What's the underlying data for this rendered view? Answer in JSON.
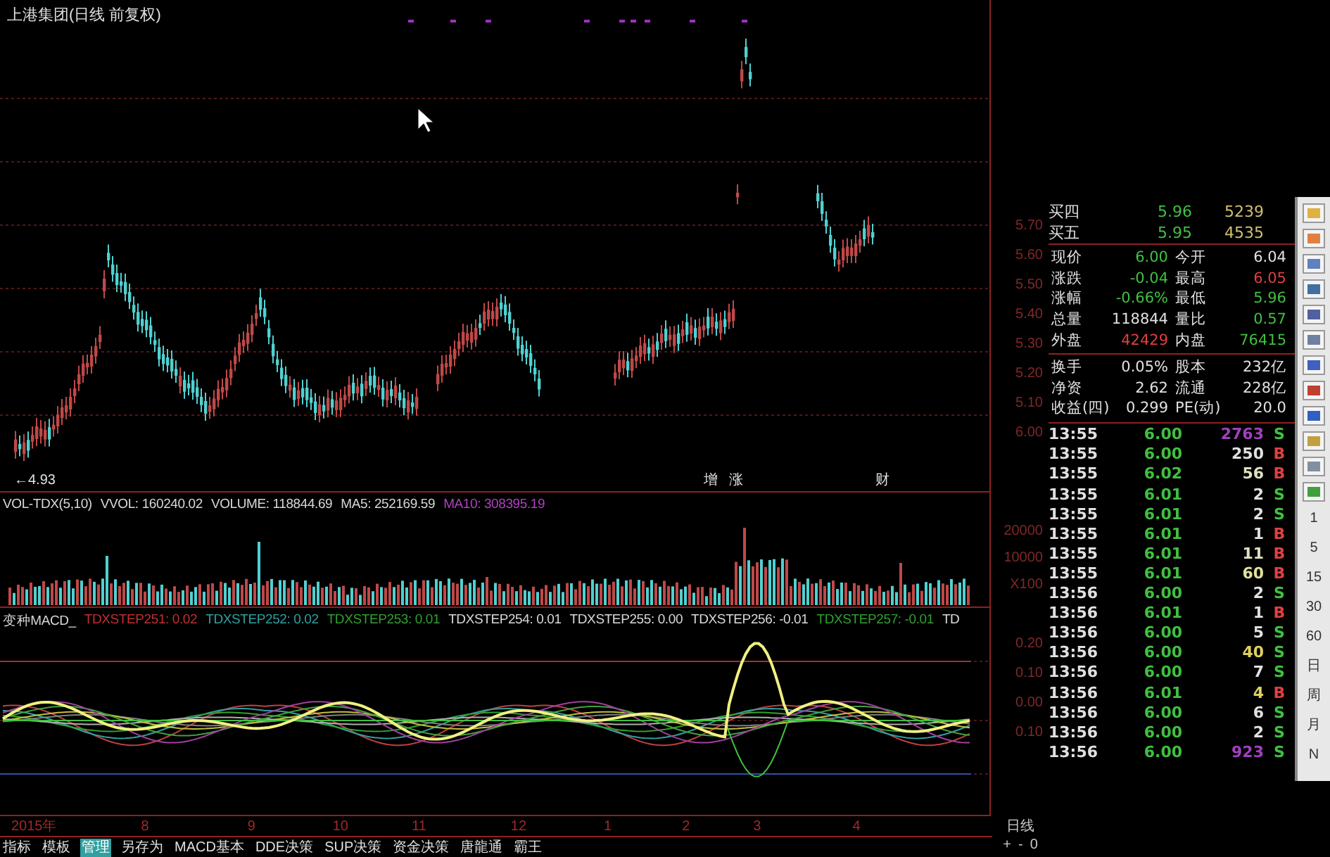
{
  "chart_title": "上港集团(日线 前复权)",
  "low_label": "←4.93",
  "event_markers": [
    "增",
    "涨",
    "财"
  ],
  "price_axis": [
    "5.70",
    "5.60",
    "5.50",
    "5.40",
    "5.30",
    "5.20",
    "5.10",
    "6.00"
  ],
  "volume": {
    "indicator": "VOL-TDX(5,10)",
    "readings": [
      {
        "text": "VVOL: 160240.02",
        "color": "#d8d8d8"
      },
      {
        "text": "VOLUME: 118844.69",
        "color": "#d8d8d8"
      },
      {
        "text": "MA5: 252169.59",
        "color": "#d8d8d8"
      },
      {
        "text": "MA10: 308395.19",
        "color": "#b040c0"
      }
    ],
    "axis": [
      "20000",
      "10000",
      "X100"
    ]
  },
  "macd": {
    "indicator": "变种MACD_",
    "readings": [
      {
        "text": "TDXSTEP251: 0.02",
        "color": "#c03030"
      },
      {
        "text": "TDXSTEP252: 0.02",
        "color": "#30a0a0"
      },
      {
        "text": "TDXSTEP253: 0.01",
        "color": "#30a030"
      },
      {
        "text": "TDXSTEP254: 0.01",
        "color": "#d8d8d8"
      },
      {
        "text": "TDXSTEP255: 0.00",
        "color": "#d8d8d8"
      },
      {
        "text": "TDXSTEP256: -0.01",
        "color": "#d8d8d8"
      },
      {
        "text": "TDXSTEP257: -0.01",
        "color": "#30a030"
      },
      {
        "text": "TD",
        "color": "#d8d8d8"
      }
    ],
    "axis": [
      "0.20",
      "0.10",
      "0.00",
      "0.10"
    ]
  },
  "date_axis": [
    "2015年",
    "8",
    "9",
    "10",
    "11",
    "12",
    "1",
    "2",
    "3",
    "4"
  ],
  "period_label": "日线",
  "zoom_controls": [
    "+",
    "-",
    "0"
  ],
  "tabs": [
    {
      "label": "指标",
      "selected": false
    },
    {
      "label": "模板",
      "selected": false
    },
    {
      "label": "管理",
      "selected": true
    },
    {
      "label": "另存为",
      "selected": false
    },
    {
      "label": "MACD基本",
      "selected": false
    },
    {
      "label": "DDE决策",
      "selected": false
    },
    {
      "label": "SUP决策",
      "selected": false
    },
    {
      "label": "资金决策",
      "selected": false
    },
    {
      "label": "唐龍通",
      "selected": false
    },
    {
      "label": "霸王",
      "selected": false
    }
  ],
  "quote": {
    "bids": [
      {
        "label": "买四",
        "price": "5.96",
        "volume": "5239"
      },
      {
        "label": "买五",
        "price": "5.95",
        "volume": "4535"
      }
    ],
    "sections": [
      [
        {
          "left": {
            "label": "现价",
            "value": "6.00",
            "color": "#40c040"
          },
          "right": {
            "label": "今开",
            "value": "6.04",
            "color": "#e0e0e0"
          }
        },
        {
          "left": {
            "label": "涨跌",
            "value": "-0.04",
            "color": "#40c040"
          },
          "right": {
            "label": "最高",
            "value": "6.05",
            "color": "#e04040"
          }
        },
        {
          "left": {
            "label": "涨幅",
            "value": "-0.66%",
            "color": "#40c040"
          },
          "right": {
            "label": "最低",
            "value": "5.96",
            "color": "#40c040"
          }
        },
        {
          "left": {
            "label": "总量",
            "value": "118844",
            "color": "#e0e0e0"
          },
          "right": {
            "label": "量比",
            "value": "0.57",
            "color": "#40c040"
          }
        },
        {
          "left": {
            "label": "外盘",
            "value": "42429",
            "color": "#e04040"
          },
          "right": {
            "label": "内盘",
            "value": "76415",
            "color": "#40c040"
          }
        }
      ],
      [
        {
          "left": {
            "label": "换手",
            "value": "0.05%",
            "color": "#e0e0e0"
          },
          "right": {
            "label": "股本",
            "value": "232亿",
            "color": "#e0e0e0"
          }
        },
        {
          "left": {
            "label": "净资",
            "value": "2.62",
            "color": "#e0e0e0"
          },
          "right": {
            "label": "流通",
            "value": "228亿",
            "color": "#e0e0e0"
          }
        },
        {
          "left": {
            "label": "收益(四)",
            "value": "0.299",
            "color": "#e0e0e0"
          },
          "right": {
            "label": "PE(动)",
            "value": "20.0",
            "color": "#e0e0e0"
          }
        }
      ]
    ]
  },
  "trades": [
    {
      "time": "13:55",
      "price": "6.00",
      "volume": {
        "text": "2763",
        "color": "#a040c0"
      },
      "side": {
        "text": "S",
        "color": "#40c040"
      }
    },
    {
      "time": "13:55",
      "price": "6.00",
      "volume": {
        "text": "250",
        "color": "#e0e0e0"
      },
      "side": {
        "text": "B",
        "color": "#e04040"
      }
    },
    {
      "time": "13:55",
      "price": "6.02",
      "volume": {
        "text": "56",
        "color": "#e0e0c0"
      },
      "side": {
        "text": "B",
        "color": "#e04040"
      }
    },
    {
      "time": "13:55",
      "price": "6.01",
      "volume": {
        "text": "2",
        "color": "#e0e0e0"
      },
      "side": {
        "text": "S",
        "color": "#40c040"
      }
    },
    {
      "time": "13:55",
      "price": "6.01",
      "volume": {
        "text": "2",
        "color": "#e0e0e0"
      },
      "side": {
        "text": "S",
        "color": "#40c040"
      }
    },
    {
      "time": "13:55",
      "price": "6.01",
      "volume": {
        "text": "1",
        "color": "#e0e0e0"
      },
      "side": {
        "text": "B",
        "color": "#e04040"
      }
    },
    {
      "time": "13:55",
      "price": "6.01",
      "volume": {
        "text": "11",
        "color": "#e0e0c0"
      },
      "side": {
        "text": "B",
        "color": "#e04040"
      }
    },
    {
      "time": "13:55",
      "price": "6.01",
      "volume": {
        "text": "60",
        "color": "#e0e0a0"
      },
      "side": {
        "text": "B",
        "color": "#e04040"
      }
    },
    {
      "time": "13:56",
      "price": "6.00",
      "volume": {
        "text": "2",
        "color": "#e0e0e0"
      },
      "side": {
        "text": "S",
        "color": "#40c040"
      }
    },
    {
      "time": "13:56",
      "price": "6.01",
      "volume": {
        "text": "1",
        "color": "#e0e0e0"
      },
      "side": {
        "text": "B",
        "color": "#e04040"
      }
    },
    {
      "time": "13:56",
      "price": "6.00",
      "volume": {
        "text": "5",
        "color": "#e0e0e0"
      },
      "side": {
        "text": "S",
        "color": "#40c040"
      }
    },
    {
      "time": "13:56",
      "price": "6.00",
      "volume": {
        "text": "40",
        "color": "#e0d060"
      },
      "side": {
        "text": "S",
        "color": "#40c040"
      }
    },
    {
      "time": "13:56",
      "price": "6.00",
      "volume": {
        "text": "7",
        "color": "#e0e0e0"
      },
      "side": {
        "text": "S",
        "color": "#40c040"
      }
    },
    {
      "time": "13:56",
      "price": "6.01",
      "volume": {
        "text": "4",
        "color": "#e0d060"
      },
      "side": {
        "text": "B",
        "color": "#e04040"
      }
    },
    {
      "time": "13:56",
      "price": "6.00",
      "volume": {
        "text": "6",
        "color": "#e0e0e0"
      },
      "side": {
        "text": "S",
        "color": "#40c040"
      }
    },
    {
      "time": "13:56",
      "price": "6.00",
      "volume": {
        "text": "2",
        "color": "#e0e0e0"
      },
      "side": {
        "text": "S",
        "color": "#40c040"
      }
    },
    {
      "time": "13:56",
      "price": "6.00",
      "volume": {
        "text": "923",
        "color": "#a040c0"
      },
      "side": {
        "text": "S",
        "color": "#40c040"
      }
    }
  ],
  "toolbar_periods": [
    "1",
    "5",
    "15",
    "30",
    "60",
    "日",
    "周",
    "月",
    "N"
  ]
}
